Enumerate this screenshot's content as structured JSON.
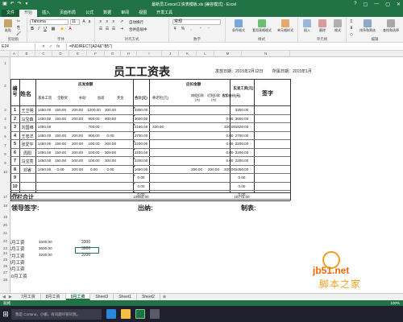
{
  "window": {
    "title": "最新员工excel工资表模板.xls [兼容模式] - Excel",
    "qa_icons": [
      "save-icon",
      "undo-icon",
      "redo-icon",
      "customize-icon"
    ],
    "controls": [
      "?",
      "▢",
      "—",
      "▢",
      "✕"
    ]
  },
  "ribbon": {
    "tabs": [
      "文件",
      "开始",
      "插入",
      "页面布局",
      "公式",
      "数据",
      "审阅",
      "视图",
      "开发工具"
    ],
    "active_tab": "开始",
    "font_name": "Tahoma",
    "font_size": "11",
    "number_format": "常规",
    "groups": [
      "剪贴板",
      "字体",
      "对齐方式",
      "数字",
      "样式",
      "单元格",
      "编辑"
    ],
    "buttons": {
      "paste": "粘贴",
      "conditional": "条件格式",
      "table_fmt": "套用表格格式",
      "cell_style": "单元格样式",
      "insert": "插入",
      "delete": "删除",
      "format": "格式",
      "sort": "排序和筛选",
      "find": "查找和选择",
      "wrap": "自动换行",
      "merge": "合并后居中"
    }
  },
  "formula_bar": {
    "name_box": "E24",
    "formula": "=INDIRECT(A24&\"!B5\")"
  },
  "columns": [
    "A",
    "B",
    "C",
    "D",
    "E",
    "F",
    "G",
    "H",
    "I",
    "J",
    "K",
    "L",
    "M",
    "N"
  ],
  "rows": [
    "1",
    "2",
    "3",
    "4",
    "5",
    "6",
    "7",
    "8",
    "9",
    "10",
    "17",
    "18",
    "19",
    "20",
    "21",
    "22",
    "23",
    "24",
    "25",
    "26",
    "27",
    "28"
  ],
  "sheet": {
    "title": "员工工资表",
    "issue_date": "发放日期：2015年2月12日",
    "tax_period": "所属日期：2015年1月",
    "headers": {
      "num": "编号",
      "name": "姓名",
      "payable": "应发金额",
      "base": "基本工资",
      "allowance": "全勤奖",
      "subsidy": "补助",
      "overtime": "加班",
      "bonus": "奖金",
      "total": "合计(元)",
      "deduct": "应扣金额",
      "social": "养老险(元)",
      "leave": "病假扣款(元)",
      "late": "迟到扣款(元)",
      "deduct_total": "应扣合计(元)",
      "net": "实发工资(元)",
      "sign": "签字"
    },
    "employees": [
      {
        "no": "1",
        "name": "王卫明",
        "v": [
          "1450.00",
          "150.00",
          "200.00",
          "1200.00",
          "300.00",
          "3300.00",
          "",
          "",
          "",
          "",
          "3300.00"
        ]
      },
      {
        "no": "2",
        "name": "马宝森",
        "v": [
          "1450.00",
          "150.00",
          "200.00",
          "900.00",
          "900.00",
          "3600.00",
          "",
          "",
          "",
          "0.00",
          "3600.00"
        ]
      },
      {
        "no": "3",
        "name": "刘国维",
        "v": [
          "1450.00",
          "",
          "",
          "700.00",
          "",
          "2150.00",
          "330.00",
          "",
          "",
          "330.00",
          "1820.00"
        ]
      },
      {
        "no": "4",
        "name": "王忠洋",
        "v": [
          "1450.00",
          "150.00",
          "200.00",
          "900.00",
          "0.00",
          "2700.00",
          "",
          "",
          "",
          "0.00",
          "2700.00"
        ]
      },
      {
        "no": "5",
        "name": "张爱平",
        "v": [
          "1450.00",
          "150.00",
          "200.00",
          "100.00",
          "300.00",
          "2200.00",
          "",
          "",
          "",
          "0.00",
          "2200.00"
        ]
      },
      {
        "no": "6",
        "name": "周阳",
        "v": [
          "1450.00",
          "150.00",
          "200.00",
          "100.00",
          "300.00",
          "2200.00",
          "",
          "",
          "",
          "0.00",
          "2200.00"
        ]
      },
      {
        "no": "7",
        "name": "马宝亮",
        "v": [
          "1450.00",
          "150.00",
          "200.00",
          "100.00",
          "300.00",
          "2200.00",
          "",
          "",
          "",
          "0.00",
          "2200.00"
        ]
      },
      {
        "no": "8",
        "name": "邓睿",
        "v": [
          "1450.00",
          "0.00",
          "200.00",
          "0.00",
          "0.00",
          "1650.00",
          "",
          "200.00",
          "200.00",
          "200.00",
          "1450.00"
        ]
      }
    ],
    "empty_rows": [
      {
        "no": "9",
        "total": "0.00",
        "net": "0.00"
      },
      {
        "no": "10",
        "total": "0.00",
        "net": "0.00"
      },
      {
        "no": "11",
        "total": "0.00",
        "net": "0.00"
      }
    ],
    "subtotal_label": "分栏合计",
    "subtotal_total": "19650.00",
    "subtotal_net": "18770.00",
    "sign_leader": "领导签字:",
    "sign_cashier": "出纳:",
    "sign_maker": "制表:",
    "summary": [
      {
        "month": "5月工资",
        "a": "3300.00",
        "b": "3300"
      },
      {
        "month": "6月工资",
        "a": "3600.00",
        "b": "3600"
      },
      {
        "month": "7月工资",
        "a": "3200.00",
        "b": "3200"
      },
      {
        "month": "8月工资",
        "a": "",
        "b": ""
      },
      {
        "month": "9月工资",
        "a": "",
        "b": ""
      },
      {
        "month": "10月工资",
        "a": "",
        "b": ""
      }
    ]
  },
  "sheet_tabs": [
    "7月工资",
    "8月工资",
    "9月工资",
    "Sheet3",
    "Sheet1",
    "Sheet2"
  ],
  "active_sheet": "9月工资",
  "status": {
    "left": "就绪",
    "right": "100%"
  },
  "taskbar": {
    "search": "我是 Cortana，小娜。有问题尽管问我。"
  },
  "watermark": {
    "line1": "jb51.net",
    "line2": "脚本之家"
  },
  "colors": {
    "excel_green": "#217346",
    "grid_green": "#1e7b3a",
    "watermark": "#ff6600"
  }
}
